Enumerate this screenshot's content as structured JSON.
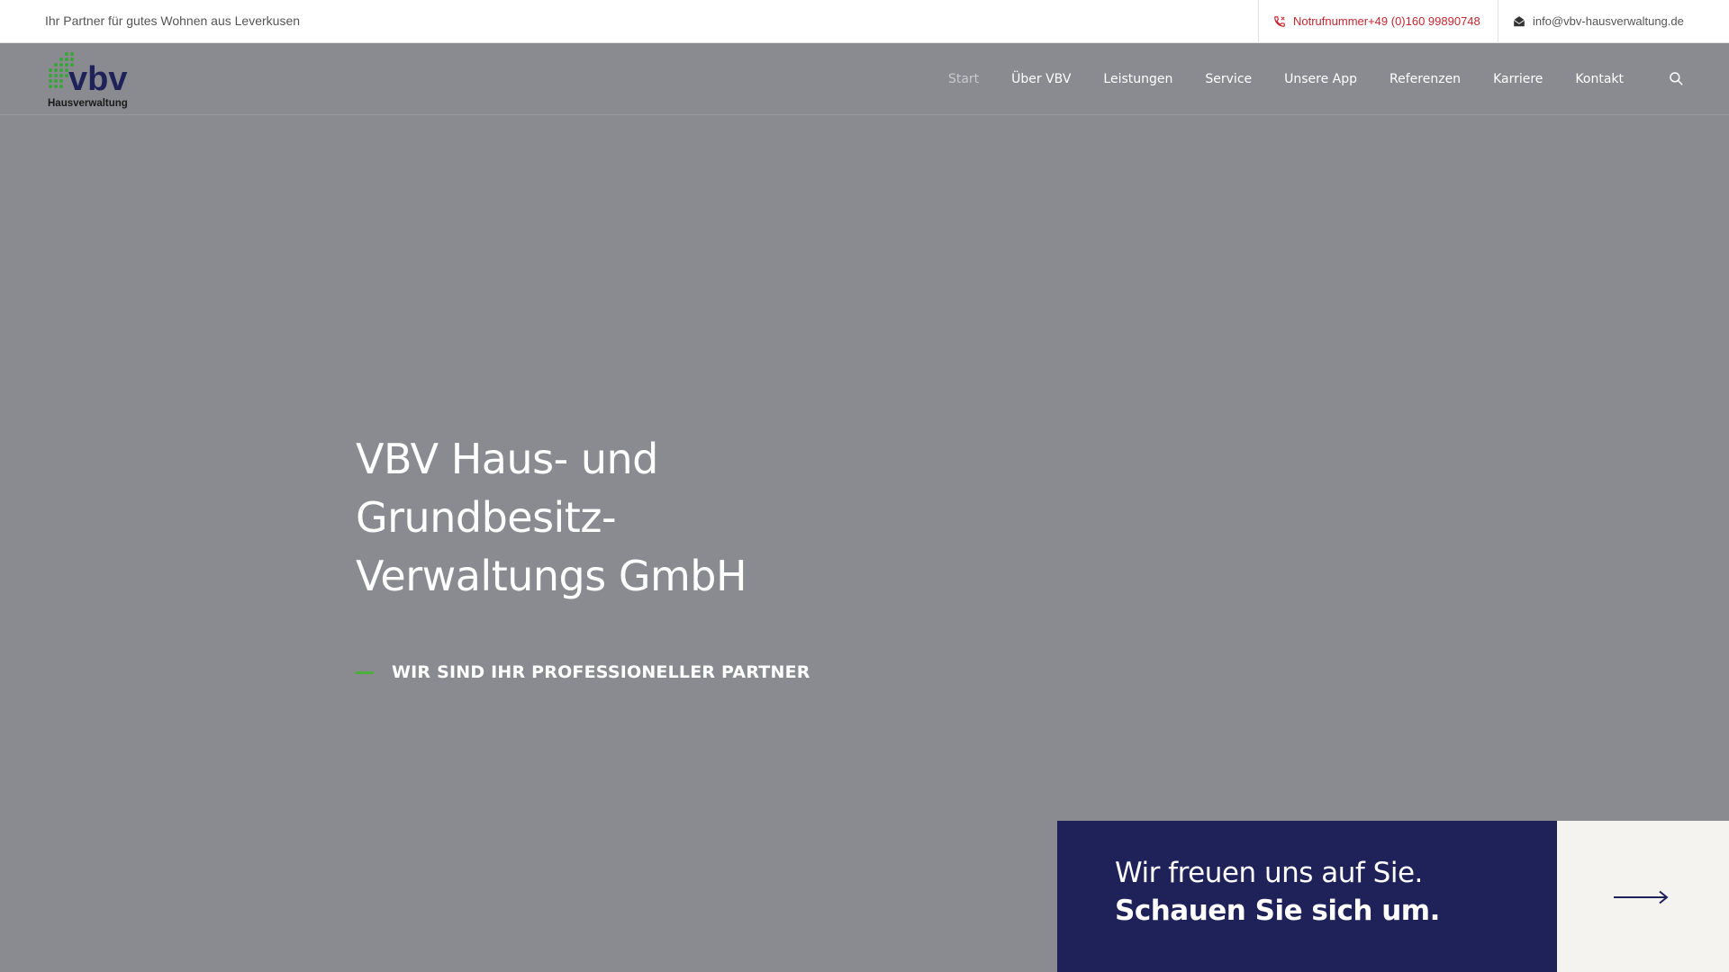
{
  "topbar": {
    "tagline": "Ihr Partner für gutes Wohnen aus Leverkusen",
    "emergency": "Notrufnummer+49 (0)160 99890748",
    "email": "info@vbv-hausverwaltung.de",
    "phone_color": "#c4262e"
  },
  "logo": {
    "text": "vbv",
    "subtext": "Hausverwaltung",
    "icon": "vbv-logo"
  },
  "nav": {
    "items": [
      {
        "label": "Start",
        "active": true
      },
      {
        "label": "Über VBV"
      },
      {
        "label": "Leistungen"
      },
      {
        "label": "Service"
      },
      {
        "label": "Unsere App"
      },
      {
        "label": "Referenzen"
      },
      {
        "label": "Karriere"
      },
      {
        "label": "Kontakt"
      }
    ],
    "search_icon": "search-icon"
  },
  "hero": {
    "title_lines": [
      "VBV Haus- und",
      "Grundbesitz-",
      "Verwaltungs GmbH"
    ],
    "subtitle": "WIR SIND IHR PROFESSIONELLER PARTNER",
    "accent_color": "#4caf3c"
  },
  "cta": {
    "line1": "Wir freuen uns auf Sie.",
    "line2": "Schauen Sie sich um.",
    "box_color": "#1e2259",
    "arrow_icon": "arrow-right-icon"
  }
}
